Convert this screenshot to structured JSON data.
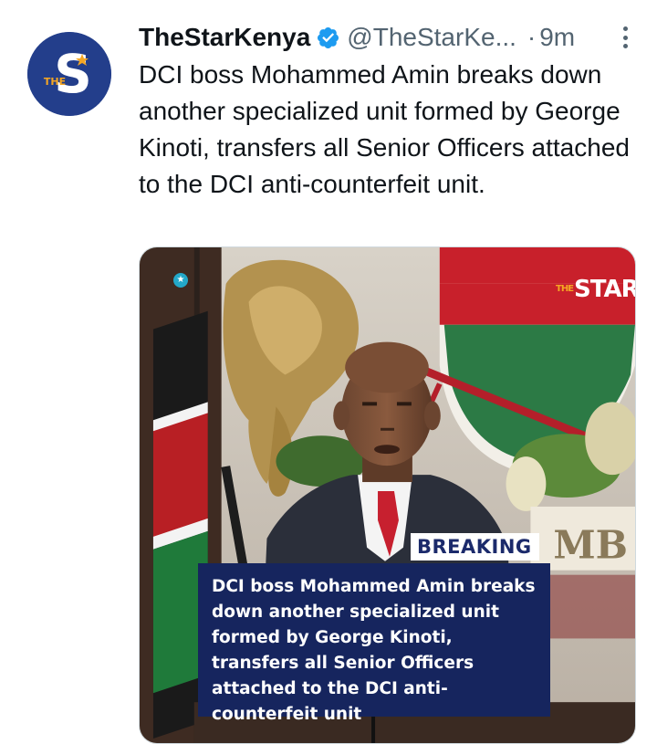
{
  "tweet": {
    "display_name": "TheStarKenya",
    "handle": "@TheStarKe...",
    "separator": "·",
    "time": "9m",
    "text": "DCI boss Mohammed Amin breaks down another specialized unit formed by George Kinoti, transfers all Senior Officers attached to the DCI anti-counterfeit unit.",
    "avatar_icon": "the-star-logo",
    "verified_icon": "verified-badge-icon",
    "more_icon": "more-options-icon"
  },
  "media": {
    "breaking_label": "BREAKING",
    "caption": "DCI boss Mohammed Amin breaks down another specialized unit formed by George Kinoti, transfers all Senior Officers attached to the DCI anti-counterfeit unit",
    "watermark": "STAR",
    "watermark_prefix": "THE",
    "background_sign": "MB"
  },
  "colors": {
    "brand_blue": "#233e8b",
    "verified_blue": "#1d9bf0",
    "caption_bg": "#16255e",
    "breaking_text": "#1b2a6b",
    "secondary_text": "#536471"
  }
}
